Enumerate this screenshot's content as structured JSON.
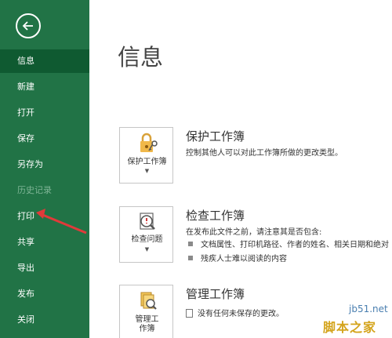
{
  "sidebar": {
    "items": [
      {
        "label": "信息",
        "state": "active"
      },
      {
        "label": "新建",
        "state": "normal"
      },
      {
        "label": "打开",
        "state": "normal"
      },
      {
        "label": "保存",
        "state": "normal"
      },
      {
        "label": "另存为",
        "state": "normal"
      },
      {
        "label": "历史记录",
        "state": "disabled"
      },
      {
        "label": "打印",
        "state": "normal"
      },
      {
        "label": "共享",
        "state": "normal"
      },
      {
        "label": "导出",
        "state": "normal"
      },
      {
        "label": "发布",
        "state": "normal"
      },
      {
        "label": "关闭",
        "state": "normal"
      }
    ],
    "back_icon": "back-arrow-icon"
  },
  "main": {
    "title": "信息",
    "sections": [
      {
        "button_label": "保护工作簿",
        "title": "保护工作簿",
        "description": "控制其他人可以对此工作簿所做的更改类型。",
        "icon": "lock-key-icon"
      },
      {
        "button_label": "检查问题",
        "title": "检查工作簿",
        "description": "在发布此文件之前，请注意其是否包含:",
        "bullets": [
          "文档属性、打印机路径、作者的姓名、相关日期和绝对",
          "残疾人士难以阅读的内容"
        ],
        "icon": "inspect-document-icon"
      },
      {
        "button_label_line1": "管理工",
        "button_label_line2": "作簿",
        "title": "管理工作簿",
        "description": "没有任何未保存的更改。",
        "icon": "manage-workbook-icon"
      }
    ]
  },
  "watermark": {
    "site": "jb51.net",
    "name": "脚本之家"
  },
  "colors": {
    "sidebar": "#217346",
    "sidebar_active": "#0f5a31",
    "arrow": "#e03a3a"
  }
}
